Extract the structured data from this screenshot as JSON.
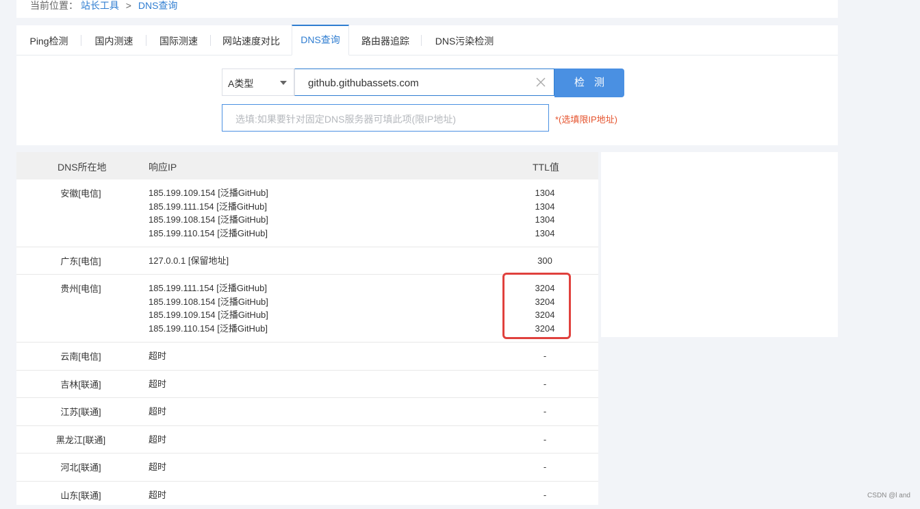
{
  "breadcrumb": {
    "prefix": "当前位置：",
    "link": "站长工具",
    "separator": ">",
    "current": "DNS查询"
  },
  "tabs": [
    {
      "label": "Ping检测"
    },
    {
      "label": "国内测速"
    },
    {
      "label": "国际测速"
    },
    {
      "label": "网站速度对比"
    },
    {
      "label": "DNS查询",
      "active": true
    },
    {
      "label": "路由器追踪"
    },
    {
      "label": "DNS污染检测"
    }
  ],
  "form": {
    "type_select": "A类型",
    "domain_value": "github.githubassets.com",
    "check_label": "检测",
    "dns_placeholder": "选填:如果要针对固定DNS服务器可填此项(限IP地址)",
    "hint": "*(选填限IP地址)"
  },
  "table": {
    "headers": {
      "location": "DNS所在地",
      "ip": "响应IP",
      "ttl": "TTL值"
    },
    "rows": [
      {
        "location": "安徽[电信]",
        "ips": [
          "185.199.109.154 [泛播GitHub]",
          "185.199.111.154 [泛播GitHub]",
          "185.199.108.154 [泛播GitHub]",
          "185.199.110.154 [泛播GitHub]"
        ],
        "ttls": [
          "1304",
          "1304",
          "1304",
          "1304"
        ]
      },
      {
        "location": "广东[电信]",
        "ips": [
          "127.0.0.1 [保留地址]"
        ],
        "ttls": [
          "300"
        ]
      },
      {
        "location": "贵州[电信]",
        "ips": [
          "185.199.111.154 [泛播GitHub]",
          "185.199.108.154 [泛播GitHub]",
          "185.199.109.154 [泛播GitHub]",
          "185.199.110.154 [泛播GitHub]"
        ],
        "ttls": [
          "3204",
          "3204",
          "3204",
          "3204"
        ],
        "highlight": true
      },
      {
        "location": "云南[电信]",
        "ips": [
          "超时"
        ],
        "ttls": [
          "-"
        ],
        "timeout": true
      },
      {
        "location": "吉林[联通]",
        "ips": [
          "超时"
        ],
        "ttls": [
          "-"
        ],
        "timeout": true
      },
      {
        "location": "江苏[联通]",
        "ips": [
          "超时"
        ],
        "ttls": [
          "-"
        ],
        "timeout": true
      },
      {
        "location": "黑龙江[联通]",
        "ips": [
          "超时"
        ],
        "ttls": [
          "-"
        ],
        "timeout": true
      },
      {
        "location": "河北[联通]",
        "ips": [
          "超时"
        ],
        "ttls": [
          "-"
        ],
        "timeout": true
      },
      {
        "location": "山东[联通]",
        "ips": [
          "超时"
        ],
        "ttls": [
          "-"
        ],
        "timeout": true
      }
    ]
  },
  "watermark": "CSDN @l and",
  "colors": {
    "accent": "#2f7dd1",
    "button": "#4a90e2",
    "timeout": "#e5532d",
    "highlight_box": "#e0413d"
  }
}
